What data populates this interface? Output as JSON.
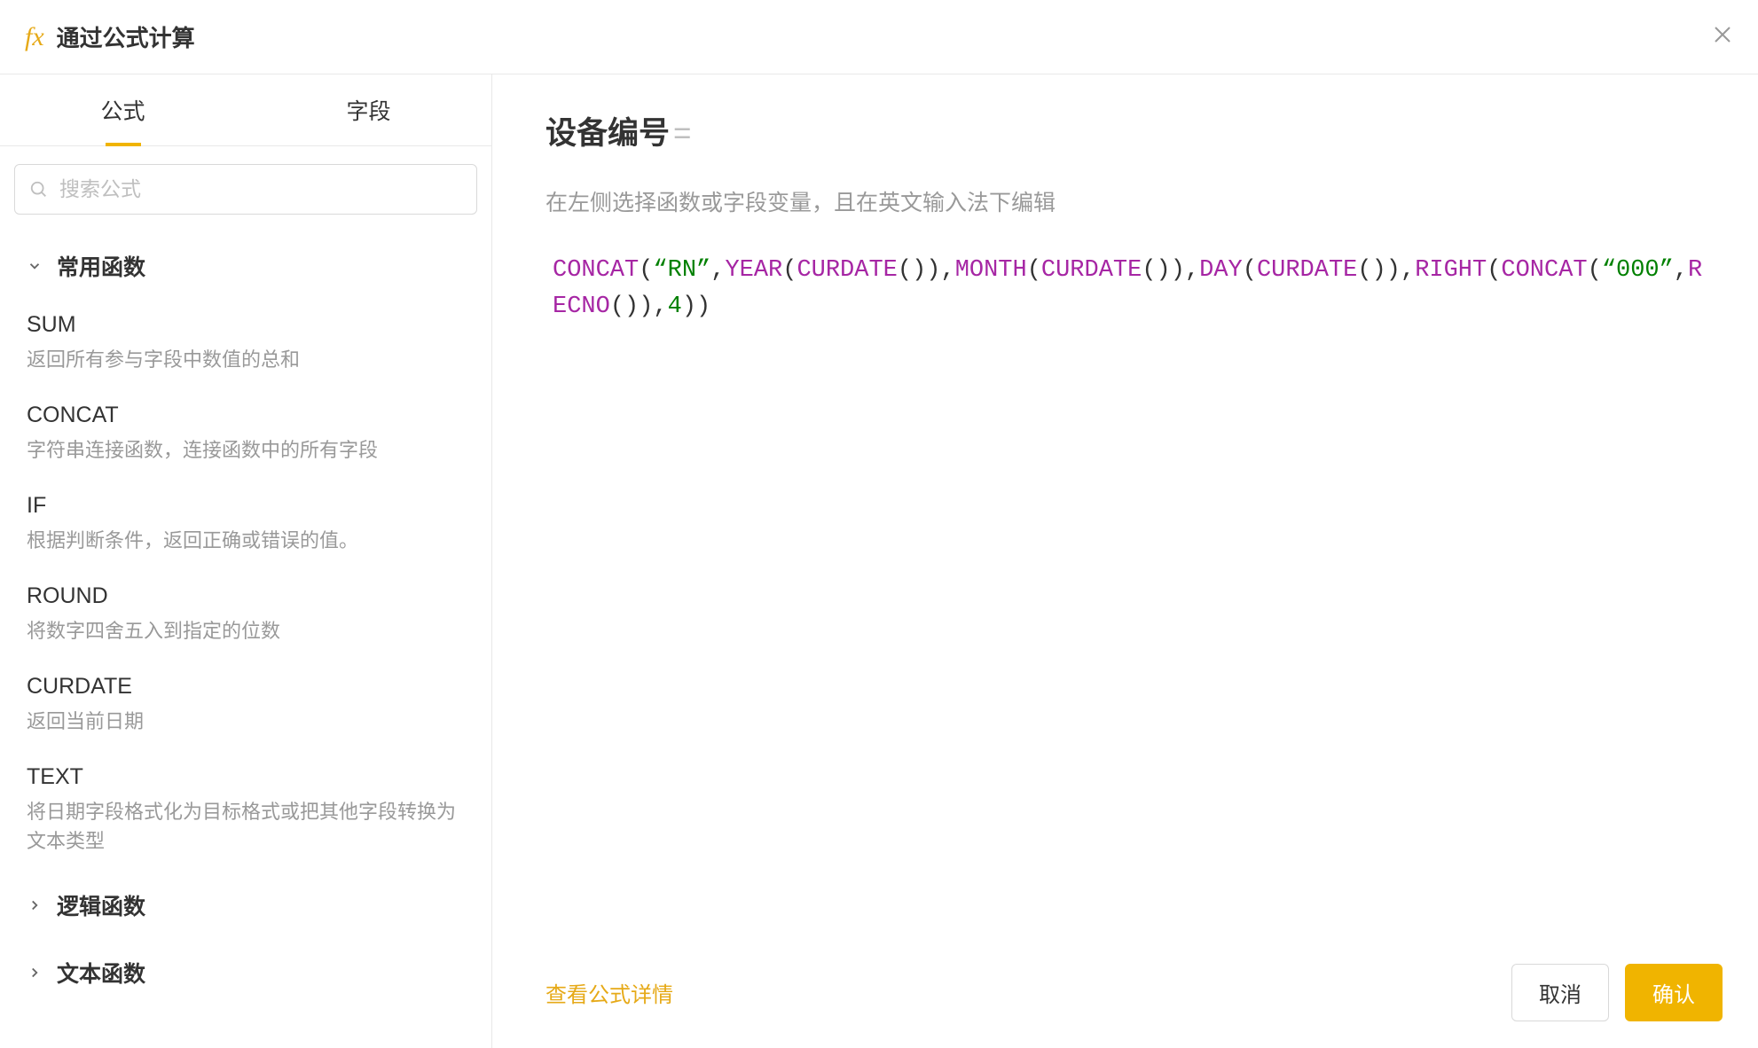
{
  "header": {
    "title": "通过公式计算",
    "fx_label": "fx"
  },
  "sidebar": {
    "tabs": [
      {
        "label": "公式",
        "active": true
      },
      {
        "label": "字段",
        "active": false
      }
    ],
    "search_placeholder": "搜索公式",
    "categories": [
      {
        "name": "常用函数",
        "expanded": true,
        "items": [
          {
            "name": "SUM",
            "desc": "返回所有参与字段中数值的总和"
          },
          {
            "name": "CONCAT",
            "desc": "字符串连接函数，连接函数中的所有字段"
          },
          {
            "name": "IF",
            "desc": "根据判断条件，返回正确或错误的值。"
          },
          {
            "name": "ROUND",
            "desc": "将数字四舍五入到指定的位数"
          },
          {
            "name": "CURDATE",
            "desc": "返回当前日期"
          },
          {
            "name": "TEXT",
            "desc": "将日期字段格式化为目标格式或把其他字段转换为文本类型"
          }
        ]
      },
      {
        "name": "逻辑函数",
        "expanded": false,
        "items": []
      },
      {
        "name": "文本函数",
        "expanded": false,
        "items": []
      }
    ]
  },
  "content": {
    "field_name": "设备编号",
    "equals": "=",
    "hint": "在左侧选择函数或字段变量，且在英文输入法下编辑",
    "formula_tokens": [
      {
        "t": "fn",
        "v": "CONCAT"
      },
      {
        "t": "paren",
        "v": "("
      },
      {
        "t": "str",
        "v": "“RN”"
      },
      {
        "t": "comma",
        "v": ","
      },
      {
        "t": "fn",
        "v": "YEAR"
      },
      {
        "t": "paren",
        "v": "("
      },
      {
        "t": "fn",
        "v": "CURDATE"
      },
      {
        "t": "paren",
        "v": "()"
      },
      {
        "t": "paren",
        "v": ")"
      },
      {
        "t": "comma",
        "v": ","
      },
      {
        "t": "fn",
        "v": "MONTH"
      },
      {
        "t": "paren",
        "v": "("
      },
      {
        "t": "fn",
        "v": "CURDATE"
      },
      {
        "t": "paren",
        "v": "()"
      },
      {
        "t": "paren",
        "v": ")"
      },
      {
        "t": "comma",
        "v": ","
      },
      {
        "t": "fn",
        "v": "DAY"
      },
      {
        "t": "paren",
        "v": "("
      },
      {
        "t": "fn",
        "v": "CURDATE"
      },
      {
        "t": "paren",
        "v": "()"
      },
      {
        "t": "paren",
        "v": ")"
      },
      {
        "t": "comma",
        "v": ","
      },
      {
        "t": "fn",
        "v": "RIGHT"
      },
      {
        "t": "paren",
        "v": "("
      },
      {
        "t": "fn",
        "v": "CONCAT"
      },
      {
        "t": "paren",
        "v": "("
      },
      {
        "t": "str",
        "v": "“000”"
      },
      {
        "t": "comma",
        "v": ","
      },
      {
        "t": "fn",
        "v": "RECNO"
      },
      {
        "t": "paren",
        "v": "()"
      },
      {
        "t": "paren",
        "v": ")"
      },
      {
        "t": "comma",
        "v": ","
      },
      {
        "t": "num",
        "v": "4"
      },
      {
        "t": "paren",
        "v": ")"
      },
      {
        "t": "paren",
        "v": ")"
      }
    ]
  },
  "footer": {
    "detail_link": "查看公式详情",
    "cancel": "取消",
    "confirm": "确认"
  }
}
